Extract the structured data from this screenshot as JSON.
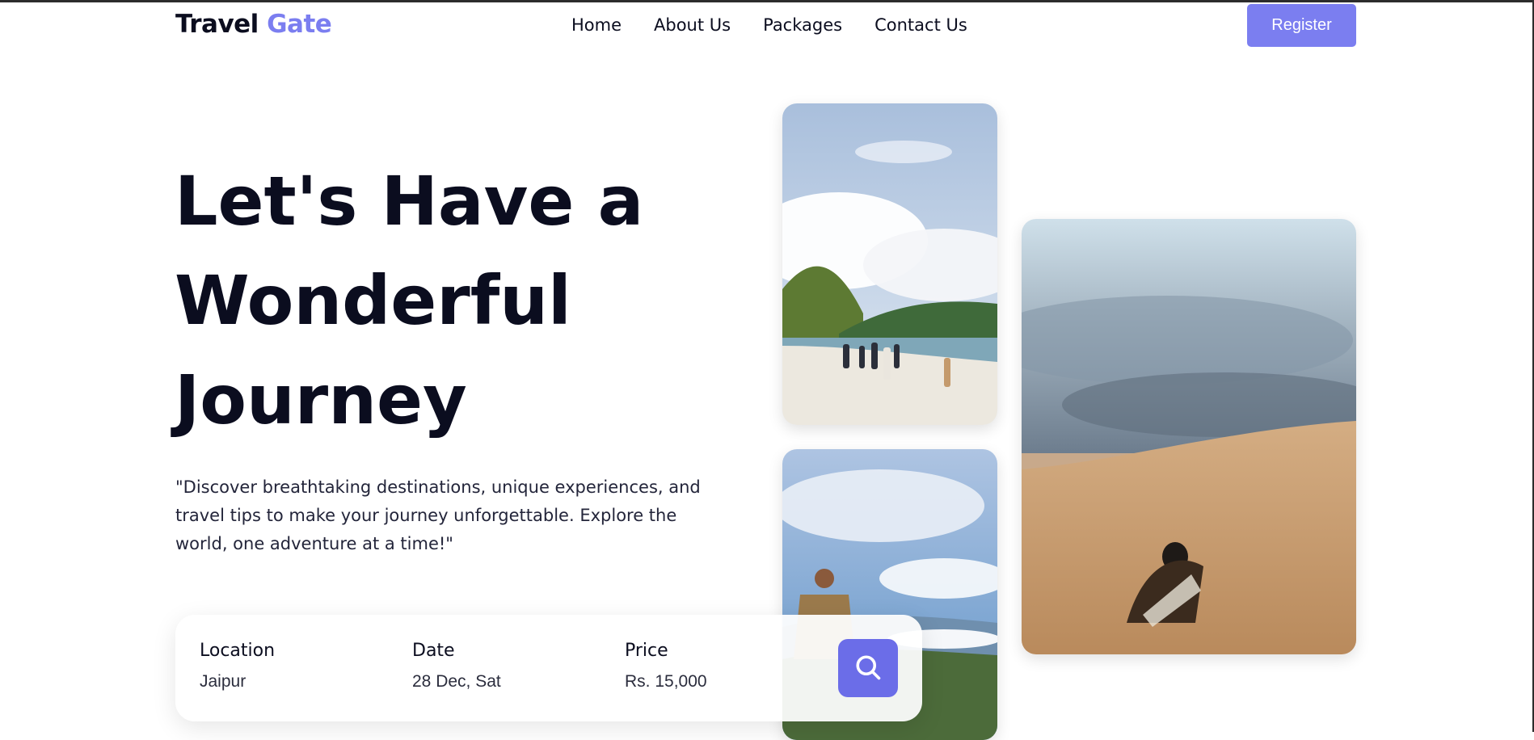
{
  "header": {
    "logo": {
      "word1": "Travel",
      "word2": "Gate"
    },
    "nav": [
      "Home",
      "About Us",
      "Packages",
      "Contact Us"
    ],
    "register_label": "Register"
  },
  "hero": {
    "title_lines": [
      "Let's Have a",
      "Wonderful",
      "Journey"
    ],
    "description": "\"Discover breathtaking destinations, unique experiences, and travel tips to make your journey unforgettable. Explore the world, one adventure at a time!\""
  },
  "search": {
    "fields": [
      {
        "label": "Location",
        "value": "Jaipur"
      },
      {
        "label": "Date",
        "value": "28 Dec, Sat"
      },
      {
        "label": "Price",
        "value": "Rs. 15,000"
      }
    ]
  },
  "images": [
    {
      "name": "beach-photo",
      "subject": "group walking on beach"
    },
    {
      "name": "hiker-photo",
      "subject": "hiker on mountain"
    },
    {
      "name": "desert-photo",
      "subject": "person in desert dunes"
    }
  ],
  "colors": {
    "accent": "#7b7ef0",
    "search_button": "#6b6de8",
    "text_dark": "#0b0d1f"
  },
  "icons": {
    "search_button": "search-icon"
  }
}
